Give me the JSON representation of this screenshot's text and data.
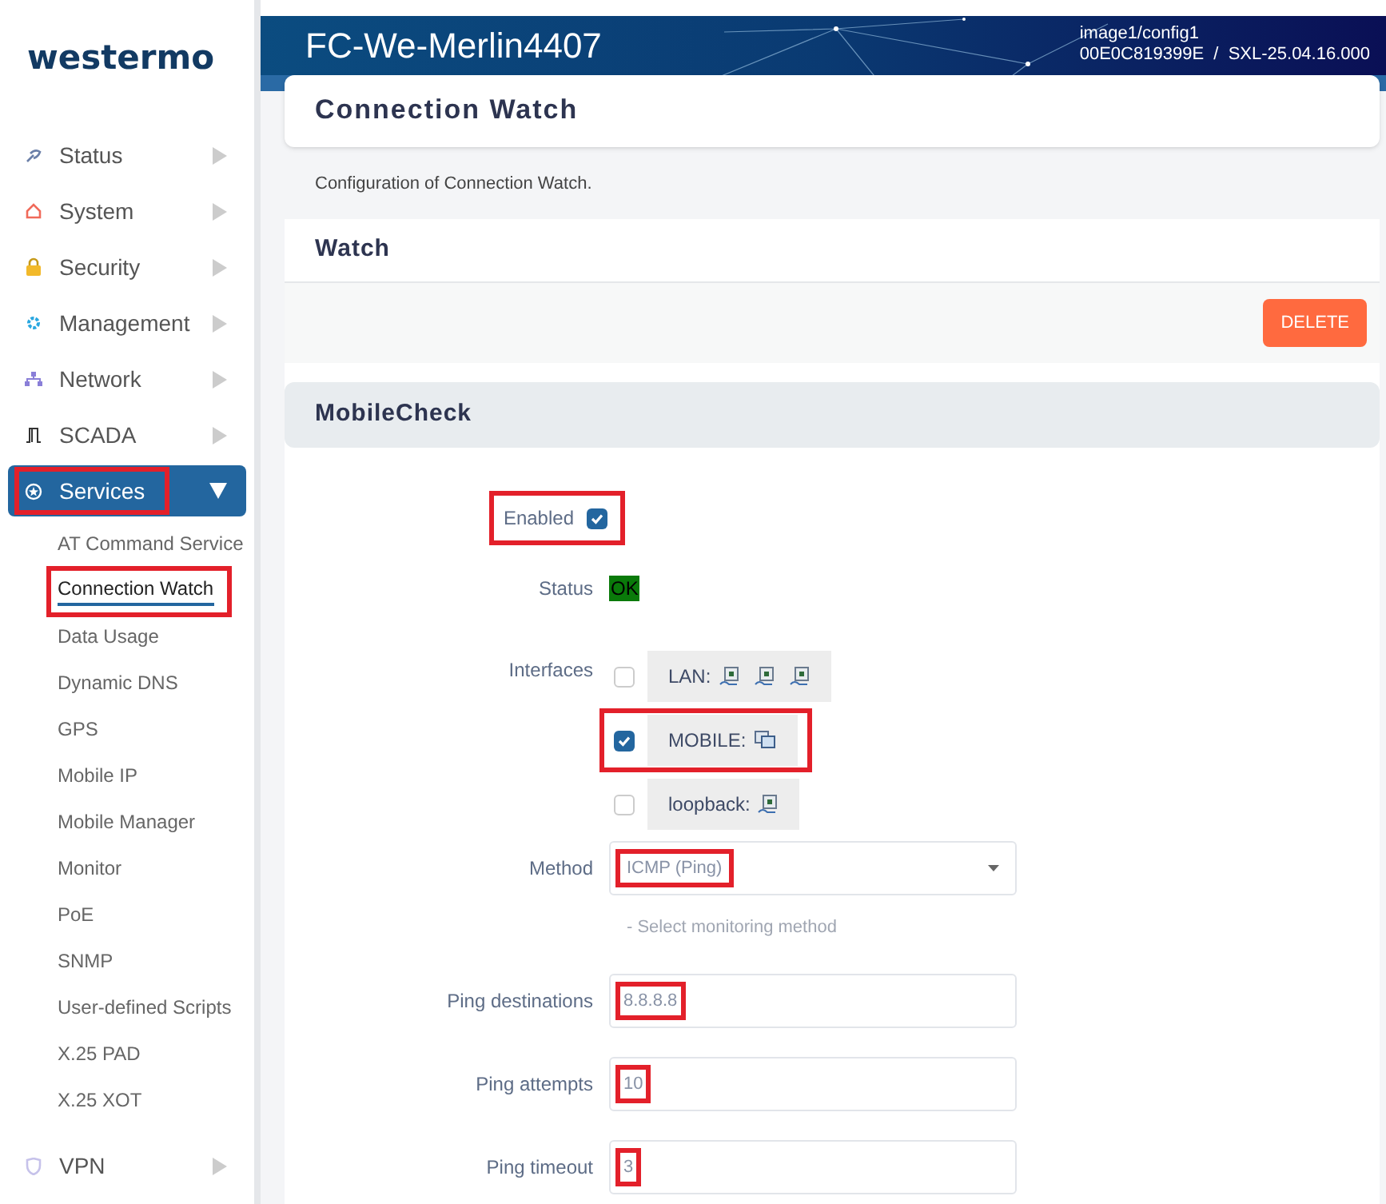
{
  "sidebar": {
    "logo": "westermo",
    "items": [
      {
        "label": "Status",
        "expanded": false,
        "selected": false,
        "highlighted": false
      },
      {
        "label": "System",
        "expanded": false,
        "selected": false,
        "highlighted": false
      },
      {
        "label": "Security",
        "expanded": false,
        "selected": false,
        "highlighted": false
      },
      {
        "label": "Management",
        "expanded": false,
        "selected": false,
        "highlighted": false
      },
      {
        "label": "Network",
        "expanded": false,
        "selected": false,
        "highlighted": false
      },
      {
        "label": "SCADA",
        "expanded": false,
        "selected": false,
        "highlighted": false
      },
      {
        "label": "Services",
        "expanded": true,
        "selected": true,
        "highlighted": true,
        "children": [
          {
            "label": "AT Command Service",
            "selected": false,
            "highlighted": false
          },
          {
            "label": "Connection Watch",
            "selected": true,
            "highlighted": true
          },
          {
            "label": "Data Usage",
            "selected": false,
            "highlighted": false
          },
          {
            "label": "Dynamic DNS",
            "selected": false,
            "highlighted": false
          },
          {
            "label": "GPS",
            "selected": false,
            "highlighted": false
          },
          {
            "label": "Mobile IP",
            "selected": false,
            "highlighted": false
          },
          {
            "label": "Mobile Manager",
            "selected": false,
            "highlighted": false
          },
          {
            "label": "Monitor",
            "selected": false,
            "highlighted": false
          },
          {
            "label": "PoE",
            "selected": false,
            "highlighted": false
          },
          {
            "label": "SNMP",
            "selected": false,
            "highlighted": false
          },
          {
            "label": "User-defined Scripts",
            "selected": false,
            "highlighted": false
          },
          {
            "label": "X.25 PAD",
            "selected": false,
            "highlighted": false
          },
          {
            "label": "X.25 XOT",
            "selected": false,
            "highlighted": false
          }
        ]
      },
      {
        "label": "VPN",
        "expanded": false,
        "selected": false,
        "highlighted": false
      }
    ]
  },
  "header": {
    "device": "FC-We-Merlin4407",
    "image": "image1/config1",
    "version": "00E0C819399E  /  SXL-25.04.16.000"
  },
  "page": {
    "title": "Connection Watch",
    "description": "Configuration of Connection Watch.",
    "section": "Watch",
    "delete_button": "DELETE",
    "subsection": "MobileCheck"
  },
  "form": [
    {
      "kind": "checkbox",
      "label": "Enabled",
      "checked": true,
      "highlighted": true
    },
    {
      "kind": "status",
      "label": "Status",
      "value": "OK"
    },
    {
      "kind": "interfaces",
      "label": "Interfaces",
      "options": [
        {
          "label": "LAN:",
          "checked": false,
          "highlighted": false
        },
        {
          "label": "MOBILE:",
          "checked": true,
          "highlighted": true
        },
        {
          "label": "loopback:",
          "checked": false,
          "highlighted": false
        }
      ]
    },
    {
      "kind": "select",
      "label": "Method",
      "value": "ICMP (Ping)",
      "hint": "- Select monitoring method",
      "highlighted": true
    },
    {
      "kind": "text",
      "label": "Ping destinations",
      "value": "8.8.8.8",
      "highlighted": true
    },
    {
      "kind": "text",
      "label": "Ping attempts",
      "value": "10",
      "highlighted": true
    },
    {
      "kind": "text",
      "label": "Ping timeout",
      "value": "3",
      "highlighted": true
    }
  ]
}
